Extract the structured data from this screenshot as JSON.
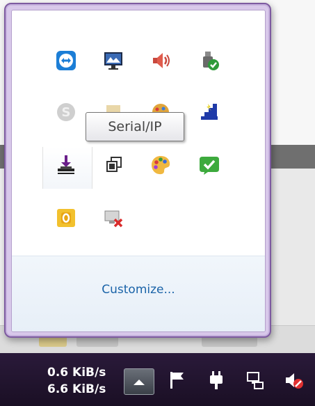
{
  "tray_popup": {
    "tooltip": "Serial/IP",
    "customize_label": "Customize...",
    "icons": [
      {
        "name": "teamviewer-icon"
      },
      {
        "name": "monitor-icon"
      },
      {
        "name": "volume-icon"
      },
      {
        "name": "safely-remove-usb-icon"
      },
      {
        "name": "skype-icon"
      },
      {
        "name": "app-icon"
      },
      {
        "name": "palette-icon"
      },
      {
        "name": "network-steps-icon"
      },
      {
        "name": "download-tray-icon"
      },
      {
        "name": "window-copy-icon"
      },
      {
        "name": "color-palette-icon"
      },
      {
        "name": "green-check-icon"
      },
      {
        "name": "outlook-icon"
      },
      {
        "name": "network-disconnected-icon"
      }
    ]
  },
  "taskbar": {
    "upload_speed": "0.6 KiB/s",
    "download_speed": "6.6 KiB/s",
    "icons": [
      "show-hidden-icons-button",
      "action-center-flag-icon",
      "power-icon",
      "network-icon",
      "volume-muted-icon"
    ]
  },
  "colors": {
    "popup_border": "#7d5aa0",
    "link": "#1a63a8",
    "taskbar": "#1e1229"
  }
}
